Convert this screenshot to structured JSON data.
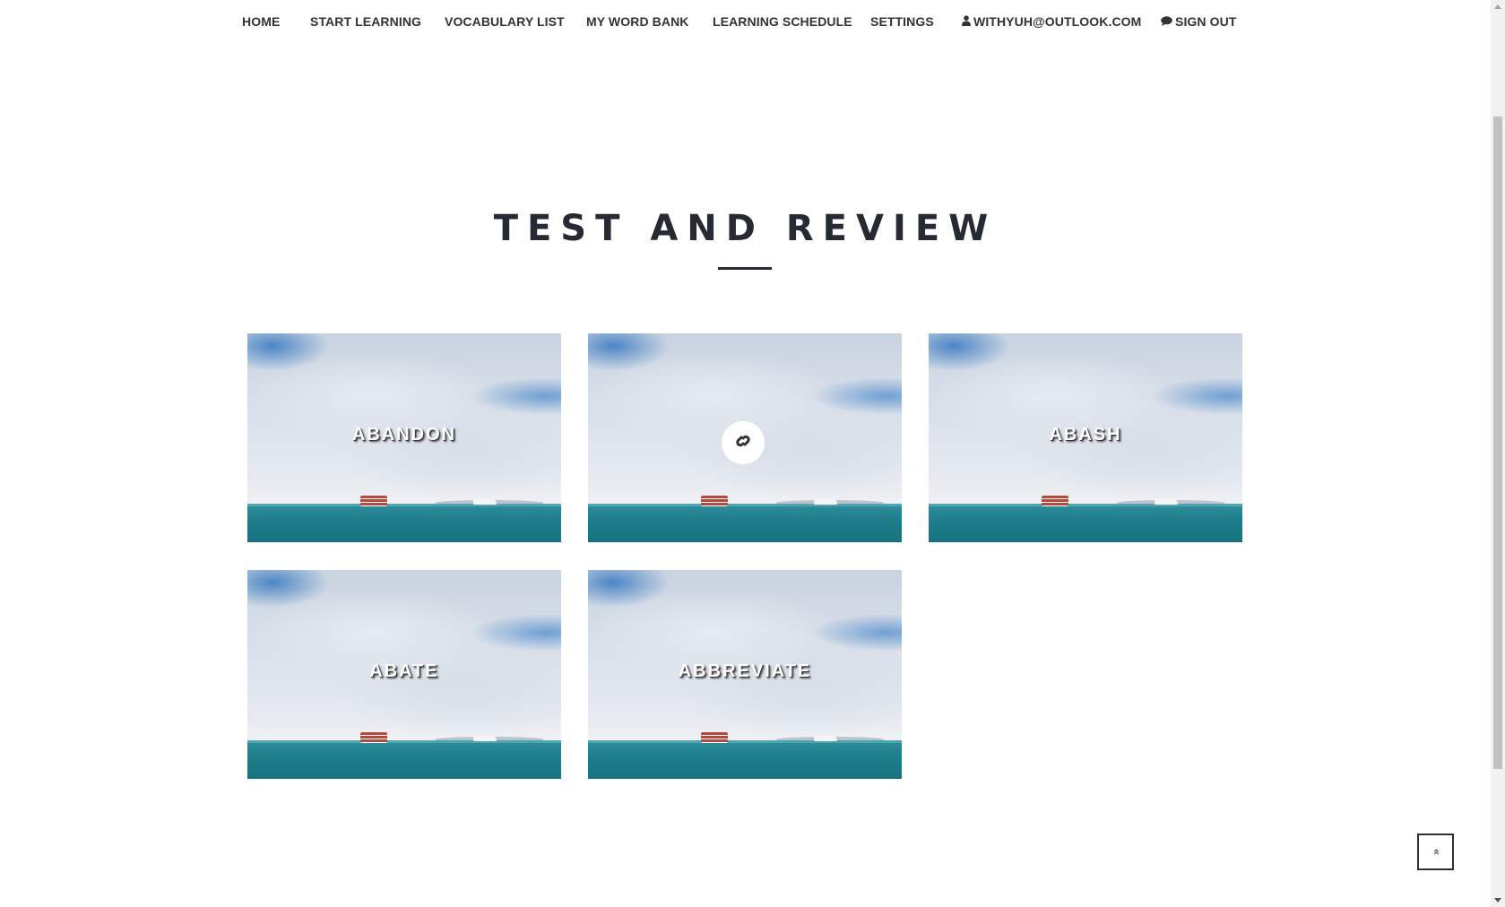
{
  "nav": {
    "items": [
      {
        "label": "HOME"
      },
      {
        "label": "START LEARNING"
      },
      {
        "label": "VOCABULARY LIST"
      },
      {
        "label": "MY WORD BANK"
      },
      {
        "label": "LEARNING SCHEDULE"
      },
      {
        "label": "SETTINGS"
      },
      {
        "label": "WITHYUH@OUTLOOK.COM",
        "icon": "user-icon"
      },
      {
        "label": "SIGN OUT",
        "icon": "comment-icon"
      }
    ]
  },
  "section": {
    "title": "TEST AND REVIEW"
  },
  "cards": [
    {
      "label": "ABANDON"
    },
    {
      "label": "",
      "icon": "link-icon"
    },
    {
      "label": "ABASH"
    },
    {
      "label": "ABATE"
    },
    {
      "label": "ABBREVIATE"
    }
  ],
  "back_to_top": {
    "glyph": "«",
    "icon": "double-chevron-up-icon"
  },
  "colors": {
    "heading": "#252a33",
    "nav_text": "#333333",
    "card_label": "#ffffff"
  }
}
